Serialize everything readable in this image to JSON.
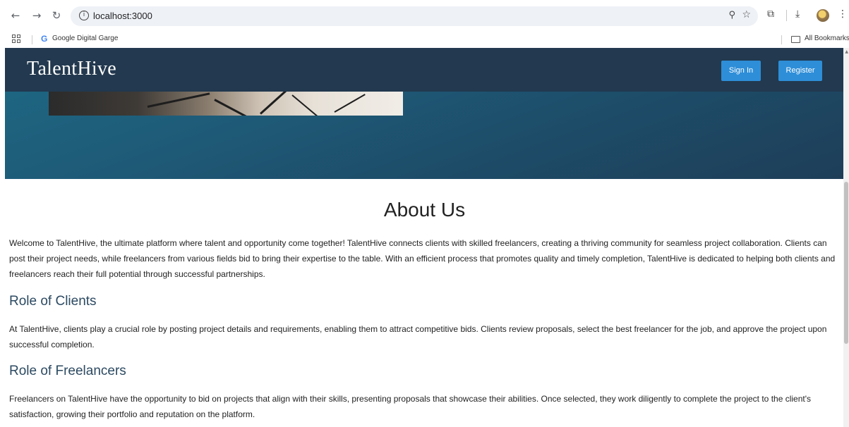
{
  "browser": {
    "url": "localhost:3000",
    "bookmarks": [
      {
        "label": "Google Digital Garge"
      }
    ],
    "all_bookmarks_label": "All Bookmarks",
    "icons": {
      "back": "arrow-left-icon",
      "forward": "arrow-right-icon",
      "reload": "reload-icon",
      "info": "info-icon",
      "zoom": "zoom-icon",
      "bookmark": "star-icon",
      "extensions": "puzzle-icon",
      "download": "download-icon",
      "menu": "kebab-menu-icon"
    }
  },
  "site": {
    "brand": "TalentHive",
    "nav": {
      "sign_in": "Sign In",
      "register": "Register"
    },
    "colors": {
      "navbar": "#22394f",
      "button": "#2e8ed8",
      "heading": "#2c4a62"
    }
  },
  "about": {
    "title": "About Us",
    "intro": "Welcome to TalentHive, the ultimate platform where talent and opportunity come together! TalentHive connects clients with skilled freelancers, creating a thriving community for seamless project collaboration. Clients can post their project needs, while freelancers from various fields bid to bring their expertise to the table. With an efficient process that promotes quality and timely completion, TalentHive is dedicated to helping both clients and freelancers reach their full potential through successful partnerships.",
    "clients_heading": "Role of Clients",
    "clients_text": "At TalentHive, clients play a crucial role by posting project details and requirements, enabling them to attract competitive bids. Clients review proposals, select the best freelancer for the job, and approve the project upon successful completion.",
    "freelancers_heading": "Role of Freelancers",
    "freelancers_text": "Freelancers on TalentHive have the opportunity to bid on projects that align with their skills, presenting proposals that showcase their abilities. Once selected, they work diligently to complete the project to the client's satisfaction, growing their portfolio and reputation on the platform."
  }
}
